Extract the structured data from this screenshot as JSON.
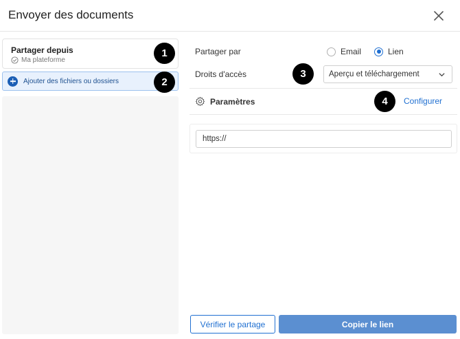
{
  "dialog": {
    "title": "Envoyer des documents"
  },
  "left_panel": {
    "from_title": "Partager depuis",
    "from_source": "Ma plateforme",
    "add_files_label": "Ajouter des fichiers ou dossiers"
  },
  "right_panel": {
    "share_by_label": "Partager par",
    "share_options": [
      {
        "label": "Email",
        "selected": false
      },
      {
        "label": "Lien",
        "selected": true
      }
    ],
    "access_rights_label": "Droits d'accès",
    "access_rights_value": "Aperçu et téléchargement",
    "settings_label": "Paramètres",
    "configure_link": "Configurer",
    "link_value": "https://"
  },
  "footer": {
    "verify_button": "Vérifier le partage",
    "copy_button": "Copier le lien"
  },
  "annotations": [
    "1",
    "2",
    "3",
    "4"
  ],
  "colors": {
    "accent": "#1f6fd1",
    "primary_button": "#5b8fd1",
    "add_button_bg": "#e8f1fd",
    "badge": "#000000"
  }
}
